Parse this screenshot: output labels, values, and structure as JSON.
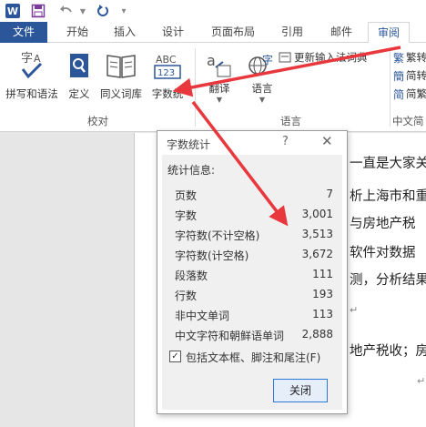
{
  "quick_access": {
    "word_logo": "W",
    "icons": [
      "word-logo",
      "save-icon",
      "undo-icon",
      "redo-icon",
      "customize-icon"
    ]
  },
  "tabs": [
    {
      "label": "文件"
    },
    {
      "label": "开始"
    },
    {
      "label": "插入"
    },
    {
      "label": "设计"
    },
    {
      "label": "页面布局"
    },
    {
      "label": "引用"
    },
    {
      "label": "邮件"
    },
    {
      "label": "审阅"
    }
  ],
  "ribbon": {
    "proofing": {
      "buttons": [
        "拼写和语法",
        "定义",
        "同义词库",
        "字数统"
      ],
      "group_label": "校对"
    },
    "language": {
      "translate": "翻译",
      "language": "语言",
      "update_ime": "更新输入法词典",
      "group_label": "语言"
    },
    "chinese": {
      "items": [
        "繁转",
        "简转",
        "简繁"
      ],
      "group_label": "中文简"
    }
  },
  "document": {
    "lines": [
      "一直是大家关",
      "析上海市和重",
      "与房地产税",
      "软件对数据",
      "测，分析结果",
      "地产税收；房"
    ]
  },
  "dialog": {
    "title": "字数统计",
    "help": "?",
    "close_x": "✕",
    "stats_header": "统计信息:",
    "stats": [
      {
        "label": "页数",
        "value": "7"
      },
      {
        "label": "字数",
        "value": "3,001"
      },
      {
        "label": "字符数(不计空格)",
        "value": "3,513"
      },
      {
        "label": "字符数(计空格)",
        "value": "3,672"
      },
      {
        "label": "段落数",
        "value": "111"
      },
      {
        "label": "行数",
        "value": "193"
      },
      {
        "label": "非中文单词",
        "value": "113"
      },
      {
        "label": "中文字符和朝鲜语单词",
        "value": "2,888"
      }
    ],
    "include_checkbox": {
      "checked": true,
      "mark": "✓",
      "label": "包括文本框、脚注和尾注(F)"
    },
    "close_button": "关闭"
  },
  "colors": {
    "word_blue": "#2b579a",
    "arrow_red": "#e8383d"
  }
}
